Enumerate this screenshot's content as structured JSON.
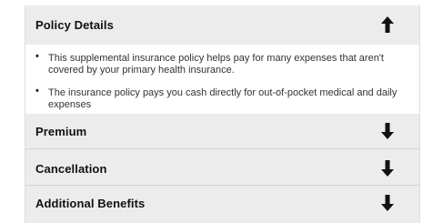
{
  "sections": [
    {
      "title": "Policy Details",
      "expanded": true,
      "arrow_icon": "arrow-up-icon",
      "bullets": [
        "This supplemental insurance policy helps pay for many expenses that aren't covered by your primary health insurance.",
        "The insurance policy pays you cash directly for out-of-pocket medical and daily expenses"
      ]
    },
    {
      "title": "Premium",
      "expanded": false,
      "arrow_icon": "arrow-down-icon"
    },
    {
      "title": "Cancellation",
      "expanded": false,
      "arrow_icon": "arrow-down-icon"
    },
    {
      "title": "Additional Benefits",
      "expanded": false,
      "arrow_icon": "arrow-down-icon"
    }
  ],
  "bullet_glyph": "•",
  "colors": {
    "header_bg": "#ececec",
    "panel_bg": "#ffffff",
    "title_text": "#111111",
    "body_text": "#333333",
    "divider": "#d4d4d4"
  }
}
